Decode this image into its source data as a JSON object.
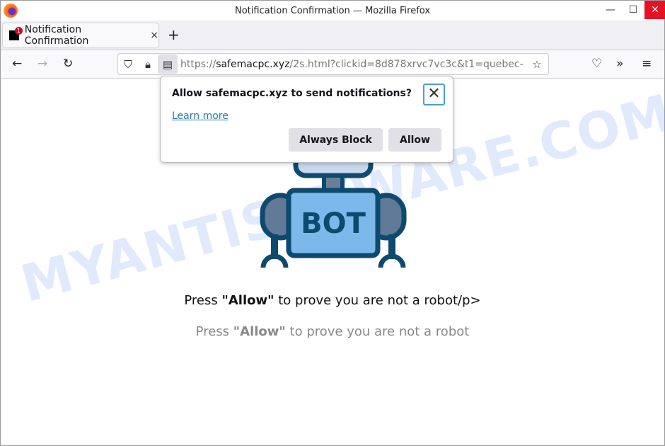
{
  "window": {
    "title": "Notification Confirmation — Mozilla Firefox",
    "minimize": "—",
    "maximize": "☐",
    "close": "✕"
  },
  "tab": {
    "label": "Notification Confirmation",
    "badge": "1",
    "close": "×",
    "new_tab": "+"
  },
  "nav": {
    "back": "←",
    "forward": "→",
    "reload": "↻",
    "url_scheme": "https://",
    "url_host": "safemacpc.xyz",
    "url_path": "/2s.html?clickid=8d878xrvc7vc3c&t1=quebec-",
    "star": "☆",
    "pocket": "♡",
    "more": "»",
    "menu": "≡"
  },
  "popup": {
    "title": "Allow safemacpc.xyz to send notifications?",
    "learn_more": "Learn more",
    "close": "✕",
    "block": "Always Block",
    "allow": "Allow"
  },
  "page": {
    "bot_label": "BOT",
    "line1_pre": "Press ",
    "line1_bold": "\"Allow\"",
    "line1_post": " to prove you are not a robot/p>",
    "line2_pre": "Press ",
    "line2_bold": "\"Allow\"",
    "line2_post": " to prove you are not a robot"
  },
  "watermark": "MYANTISPYWARE.COM"
}
